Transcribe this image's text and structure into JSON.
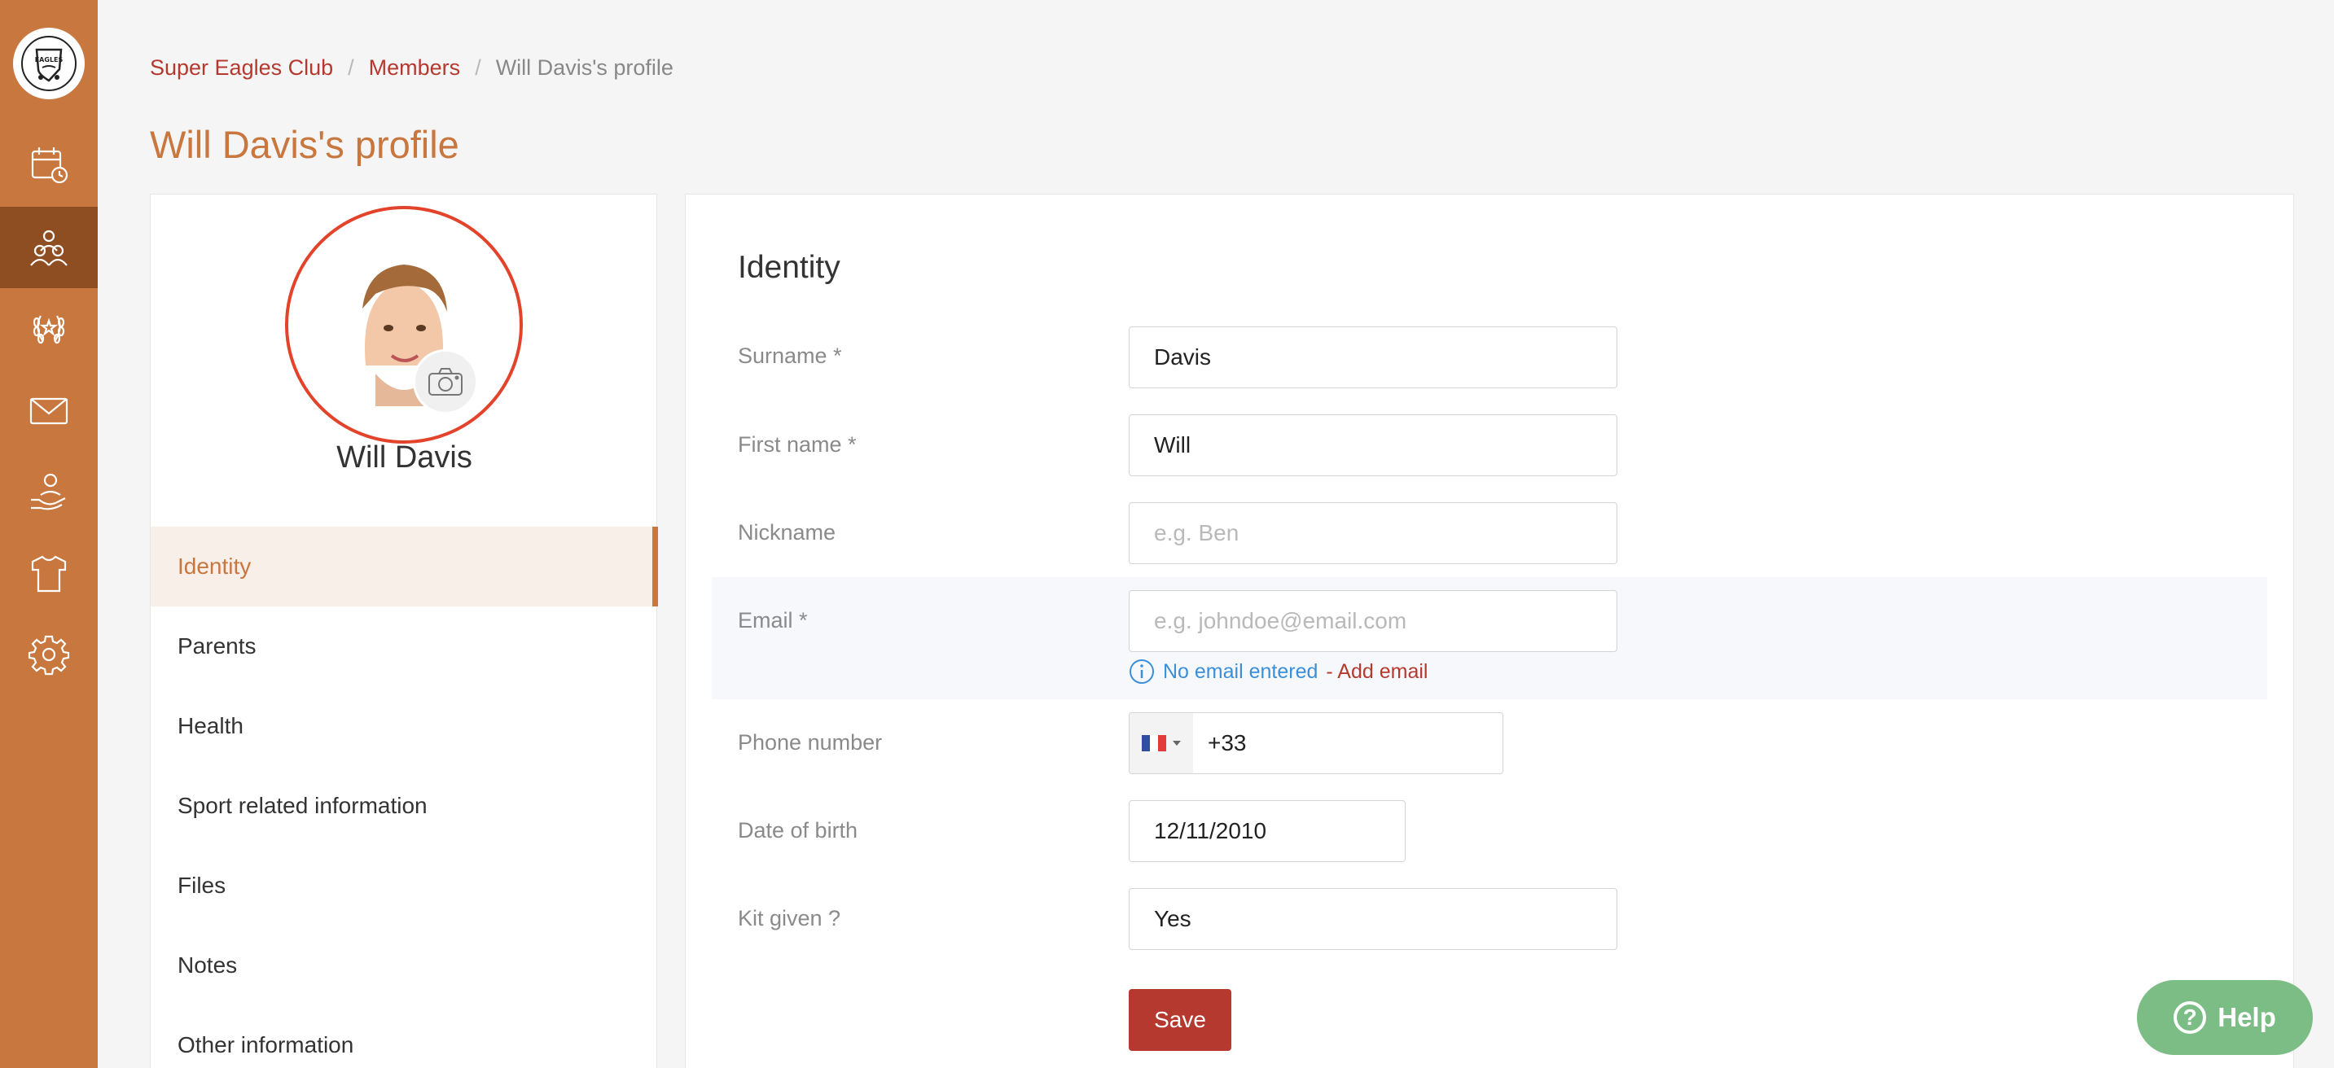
{
  "app": {
    "logo_text": "EAGLES",
    "brand_color": "#c8773f",
    "accent_color": "#b5392f"
  },
  "sidebar": {
    "items": [
      {
        "name": "calendar",
        "icon": "calendar-clock-icon",
        "active": false
      },
      {
        "name": "members",
        "icon": "people-icon",
        "active": true
      },
      {
        "name": "achievements",
        "icon": "laurel-icon",
        "active": false
      },
      {
        "name": "messages",
        "icon": "envelope-icon",
        "active": false
      },
      {
        "name": "volunteers",
        "icon": "hand-person-icon",
        "active": false
      },
      {
        "name": "kit",
        "icon": "tshirt-icon",
        "active": false
      },
      {
        "name": "settings",
        "icon": "gear-icon",
        "active": false
      }
    ]
  },
  "breadcrumb": {
    "club": "Super Eagles Club",
    "members": "Members",
    "current": "Will Davis's profile"
  },
  "page_title": "Will Davis's profile",
  "profile": {
    "name": "Will Davis",
    "camera_icon": "camera-icon"
  },
  "menu": {
    "items": [
      {
        "label": "Identity",
        "active": true
      },
      {
        "label": "Parents"
      },
      {
        "label": "Health"
      },
      {
        "label": "Sport related information"
      },
      {
        "label": "Files"
      },
      {
        "label": "Notes"
      },
      {
        "label": "Other information"
      }
    ]
  },
  "identity": {
    "title": "Identity",
    "surname": {
      "label": "Surname *",
      "value": "Davis"
    },
    "first_name": {
      "label": "First name *",
      "value": "Will"
    },
    "nickname": {
      "label": "Nickname",
      "value": "",
      "placeholder": "e.g. Ben"
    },
    "email": {
      "label": "Email *",
      "value": "",
      "placeholder": "e.g. johndoe@email.com",
      "hint": "No email entered",
      "add_link": "- Add email"
    },
    "phone": {
      "label": "Phone number",
      "value": "+33",
      "country_flag": "FR"
    },
    "dob": {
      "label": "Date of birth",
      "value": "12/11/2010"
    },
    "kit_given": {
      "label": "Kit given ?",
      "value": "Yes"
    },
    "save_label": "Save"
  },
  "help": {
    "label": "Help"
  }
}
